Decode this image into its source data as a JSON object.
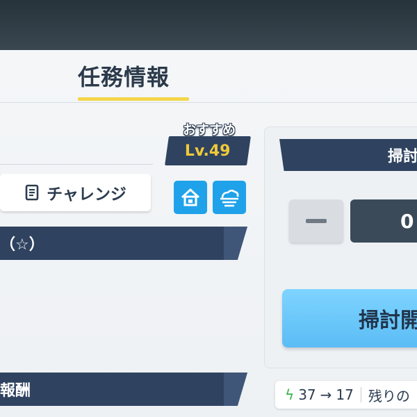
{
  "header": {
    "title": "任務情報"
  },
  "challenge": {
    "label": "チャレンジ"
  },
  "recommended": {
    "label": "おすすめ",
    "level": "Lv.49"
  },
  "section_banners": {
    "first": "（☆）",
    "second": "報酬"
  },
  "sweep": {
    "header_label": "掃討",
    "count": "0",
    "start_label": "掃討開",
    "minus_symbol": "—"
  },
  "ap": {
    "from": "37",
    "arrow": "→",
    "to": "17",
    "remaining_label": "残りの"
  },
  "colors": {
    "accent_yellow": "#f3d64a",
    "banner_navy": "#2f4360",
    "button_blue": "#1fa2ea",
    "start_blue": "#6cc8fb",
    "ap_green": "#38b24a"
  },
  "icons": [
    "note-icon",
    "home-icon",
    "cloud-icon",
    "minus-icon",
    "bolt-icon",
    "arrow-right-icon"
  ]
}
